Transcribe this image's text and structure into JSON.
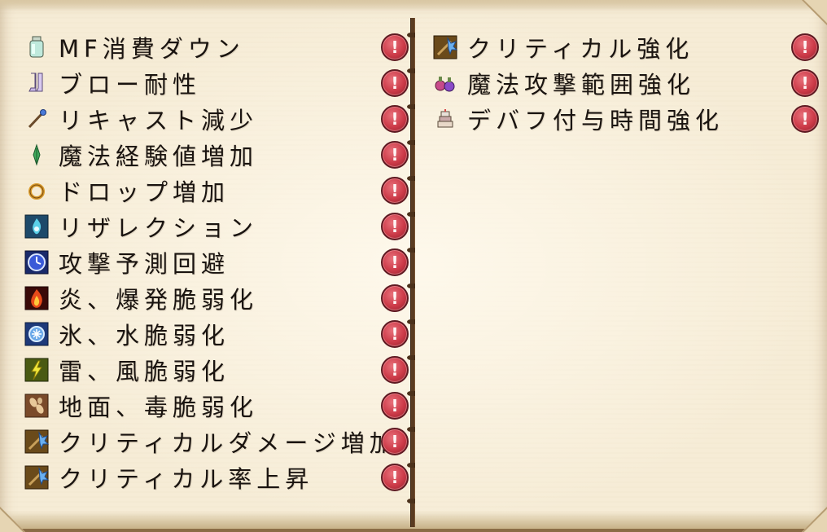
{
  "left_page": {
    "skills": [
      {
        "label": "MF消費ダウン",
        "icon": "potion-bottle-icon",
        "alert": "!"
      },
      {
        "label": "ブロー耐性",
        "icon": "boots-icon",
        "alert": "!"
      },
      {
        "label": "リキャスト減少",
        "icon": "magic-wand-icon",
        "alert": "!"
      },
      {
        "label": "魔法経験値増加",
        "icon": "green-herb-icon",
        "alert": "!"
      },
      {
        "label": "ドロップ増加",
        "icon": "gold-ring-icon",
        "alert": "!"
      },
      {
        "label": "リザレクション",
        "icon": "resurrection-flame-icon",
        "alert": "!"
      },
      {
        "label": "攻撃予測回避",
        "icon": "clock-icon",
        "alert": "!"
      },
      {
        "label": "炎、爆発脆弱化",
        "icon": "fire-icon",
        "alert": "!"
      },
      {
        "label": "氷、水脆弱化",
        "icon": "ice-icon",
        "alert": "!"
      },
      {
        "label": "雷、風脆弱化",
        "icon": "lightning-icon",
        "alert": "!"
      },
      {
        "label": "地面、毒脆弱化",
        "icon": "earth-seeds-icon",
        "alert": "!"
      },
      {
        "label": "クリティカルダメージ増加",
        "icon": "critical-staff-icon",
        "alert": "!"
      },
      {
        "label": "クリティカル率上昇",
        "icon": "critical-staff-icon",
        "alert": "!"
      }
    ]
  },
  "right_page": {
    "skills": [
      {
        "label": "クリティカル強化",
        "icon": "critical-staff-icon",
        "alert": "!"
      },
      {
        "label": "魔法攻撃範囲強化",
        "icon": "potion-cluster-icon",
        "alert": "!"
      },
      {
        "label": "デバフ付与時間強化",
        "icon": "layered-cake-icon",
        "alert": "!"
      }
    ]
  },
  "colors": {
    "page": "#f6ecd6",
    "spine": "#5a3c22",
    "text": "#1a1410",
    "alert": "#cc3a48"
  }
}
